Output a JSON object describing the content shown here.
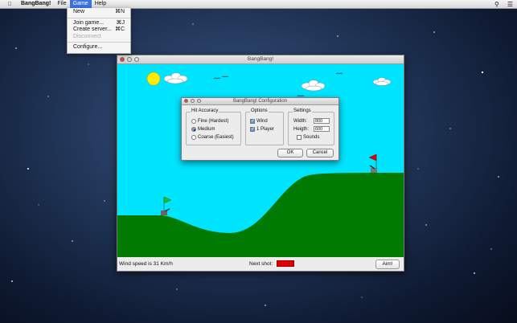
{
  "menubar": {
    "app_name": "BangBang!",
    "menus": [
      "File",
      "Game",
      "Help"
    ],
    "active_menu": "Game"
  },
  "game_menu": {
    "items": [
      {
        "label": "New",
        "shortcut": "⌘N",
        "enabled": true
      },
      {
        "label": "Join game...",
        "shortcut": "⌘J",
        "enabled": true
      },
      {
        "label": "Create server...",
        "shortcut": "⌘C",
        "enabled": true
      },
      {
        "label": "Disconnect",
        "shortcut": "",
        "enabled": false
      },
      {
        "label": "Configure...",
        "shortcut": "",
        "enabled": true
      }
    ]
  },
  "main_window": {
    "title": "BangBang!",
    "status": {
      "wind_text": "Wind speed is 31 Km/h",
      "next_shot_label": "Next shot:",
      "next_shot_color": "#e00000",
      "aim_label": "Aim!"
    }
  },
  "scene": {
    "sky_color": "#00e5ff",
    "ground_color": "#007a00",
    "sun_color": "#ffee00",
    "player_flag_color": "#22bb22",
    "enemy_flag_color": "#dd0000"
  },
  "config_dialog": {
    "title": "BangBang! Configuration",
    "hit_accuracy": {
      "title": "Hit Accuracy",
      "options": [
        "Fine (Hardest)",
        "Medium",
        "Coarse (Easiest)"
      ],
      "selected": "Medium"
    },
    "options": {
      "title": "Options",
      "wind_label": "Wind",
      "wind_checked": true,
      "one_player_label": "1 Player",
      "one_player_checked": true
    },
    "settings": {
      "title": "Settings",
      "width_label": "Width:",
      "width_value": "800",
      "height_label": "Heigth:",
      "height_value": "600",
      "sounds_label": "Sounds",
      "sounds_checked": false
    },
    "ok_label": "OK",
    "cancel_label": "Cancel"
  }
}
